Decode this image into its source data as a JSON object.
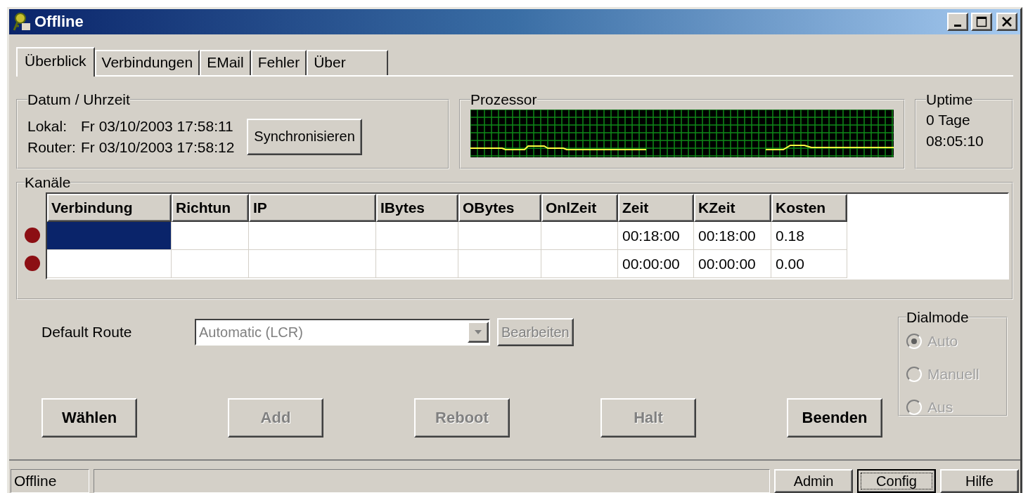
{
  "window": {
    "title": "Offline"
  },
  "tabs": [
    {
      "label": "Überblick",
      "selected": true
    },
    {
      "label": "Verbindungen",
      "selected": false
    },
    {
      "label": "EMail",
      "selected": false
    },
    {
      "label": "Fehler",
      "selected": false
    },
    {
      "label": "Über",
      "selected": false
    }
  ],
  "datetime": {
    "title": "Datum / Uhrzeit",
    "lines": [
      {
        "label": "Lokal:",
        "value": "Fr 03/10/2003 17:58:11"
      },
      {
        "label": "Router:",
        "value": "Fr 03/10/2003 17:58:12"
      }
    ],
    "button": {
      "label": "Synchronisieren",
      "disabled": false
    }
  },
  "processor": {
    "title": "Prozessor"
  },
  "uptime": {
    "title": "Uptime",
    "lines": [
      "0 Tage",
      "08:05:10"
    ]
  },
  "channels": {
    "title": "Kanäle",
    "columns": [
      "Verbindung",
      "Richtun",
      "IP",
      "IBytes",
      "OBytes",
      "OnlZeit",
      "Zeit",
      "KZeit",
      "Kosten"
    ],
    "rows": [
      {
        "color": "#8c0f14",
        "selected": true,
        "zeit": "00:18:00",
        "kzeit": "00:18:00",
        "kosten": "0.18"
      },
      {
        "color": "#8c0f14",
        "selected": false,
        "zeit": "00:00:00",
        "kzeit": "00:00:00",
        "kosten": "0.00"
      }
    ]
  },
  "default_route": {
    "label": "Default Route",
    "value": "Automatic (LCR)",
    "disabled": true,
    "button": {
      "label": "Bearbeiten",
      "disabled": true
    }
  },
  "dialmode": {
    "title": "Dialmode",
    "options": [
      {
        "label": "Auto",
        "selected": true,
        "disabled": true
      },
      {
        "label": "Manuell",
        "selected": false,
        "disabled": true
      },
      {
        "label": "Aus",
        "selected": false,
        "disabled": true
      }
    ]
  },
  "buttons": [
    {
      "label": "Wählen",
      "disabled": false
    },
    {
      "label": "Add",
      "disabled": true
    },
    {
      "label": "Reboot",
      "disabled": true
    },
    {
      "label": "Halt",
      "disabled": true
    },
    {
      "label": "Beenden",
      "disabled": false
    }
  ],
  "status_bar": {
    "text": "Offline",
    "buttons": [
      {
        "label": "Admin",
        "focused": false
      },
      {
        "label": "Config",
        "focused": true
      },
      {
        "label": "Hilfe",
        "focused": false
      }
    ]
  }
}
